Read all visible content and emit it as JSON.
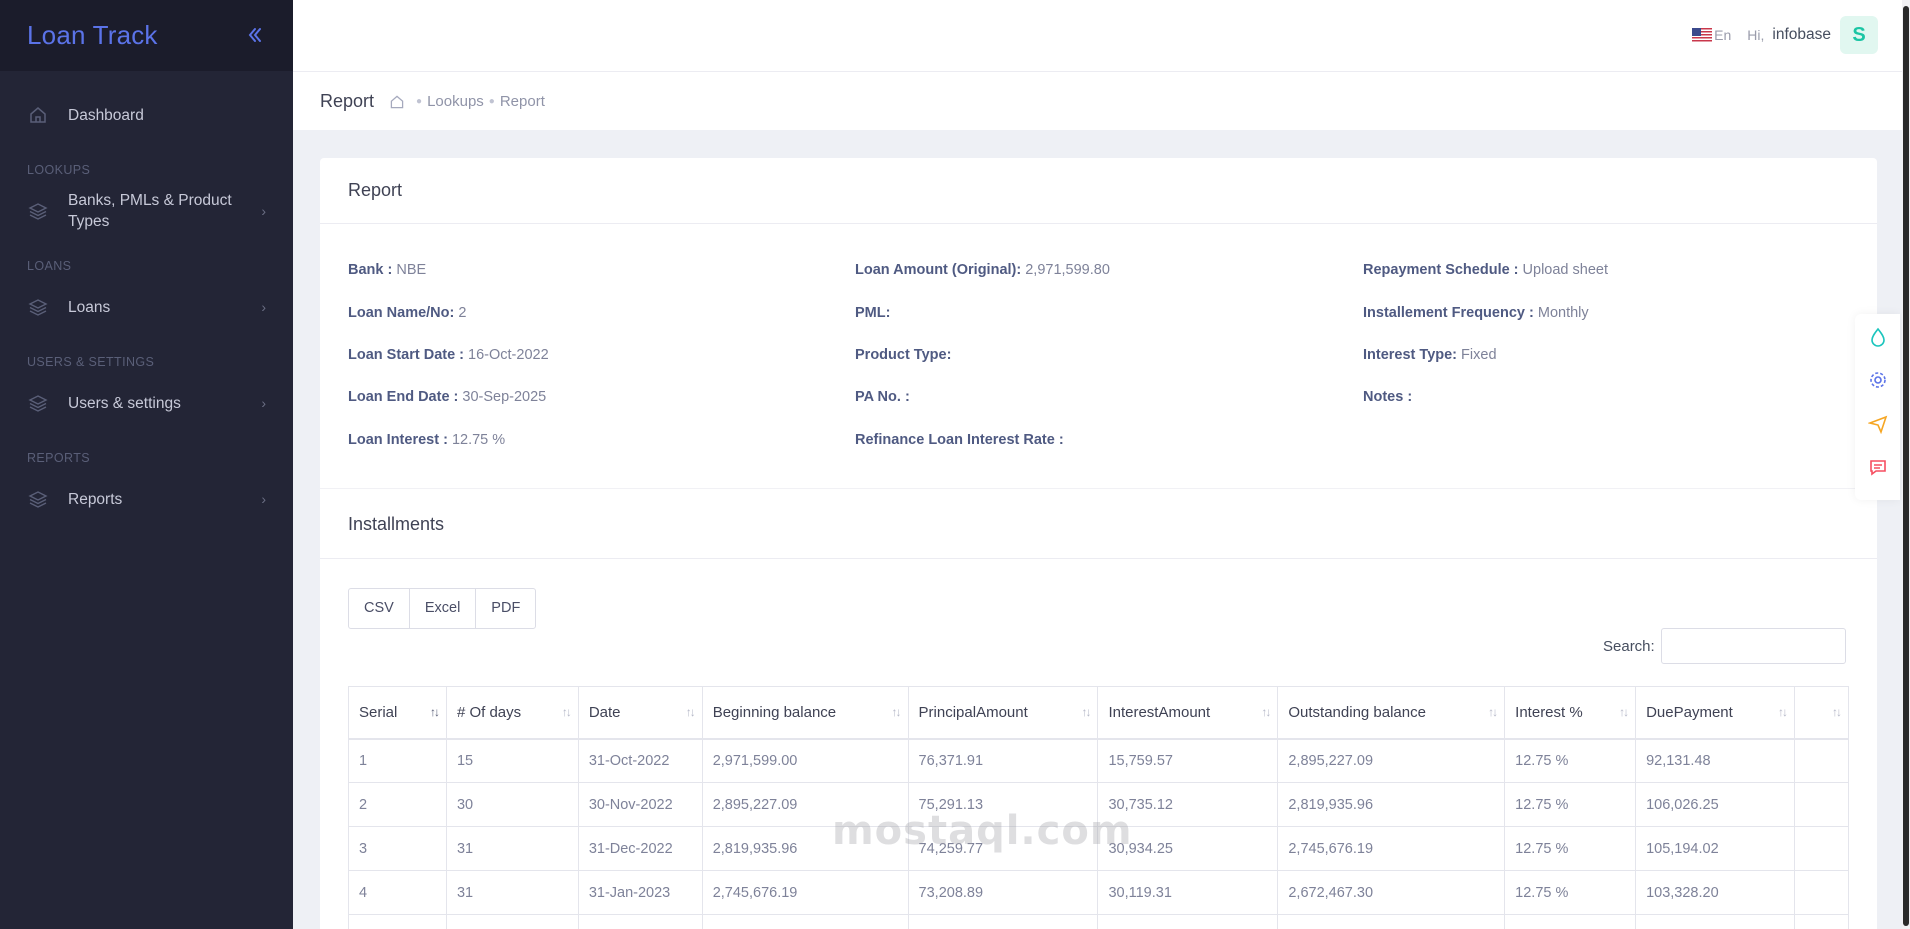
{
  "app": {
    "title": "Loan Track"
  },
  "sidebar": {
    "dashboard": "Dashboard",
    "sections": [
      "LOOKUPS",
      "LOANS",
      "USERS & SETTINGS",
      "REPORTS"
    ],
    "items": [
      {
        "label": "Banks, PMLs & Product Types",
        "icon": "layers-icon"
      },
      {
        "label": "Loans",
        "icon": "layers-icon"
      },
      {
        "label": "Users & settings",
        "icon": "layers-icon"
      },
      {
        "label": "Reports",
        "icon": "layers-icon"
      }
    ]
  },
  "header": {
    "lang": "En",
    "greeting": "Hi,",
    "username": "infobase",
    "avatar": "S"
  },
  "subheader": {
    "title": "Report",
    "crumbs": [
      "Lookups",
      "Report"
    ]
  },
  "report": {
    "title": "Report",
    "fields": {
      "bank": {
        "label": "Bank :",
        "value": "NBE"
      },
      "loan_name": {
        "label": "Loan Name/No:",
        "value": "2"
      },
      "loan_start": {
        "label": "Loan Start Date :",
        "value": "16-Oct-2022"
      },
      "loan_end": {
        "label": "Loan End Date :",
        "value": "30-Sep-2025"
      },
      "loan_interest": {
        "label": "Loan Interest :",
        "value": "12.75 %"
      },
      "loan_amount": {
        "label": "Loan Amount (Original):",
        "value": "2,971,599.80"
      },
      "pml": {
        "label": "PML:",
        "value": ""
      },
      "product_type": {
        "label": "Product Type:",
        "value": ""
      },
      "pa_no": {
        "label": "PA No. :",
        "value": ""
      },
      "refinance": {
        "label": "Refinance Loan Interest Rate :",
        "value": ""
      },
      "repayment": {
        "label": "Repayment Schedule :",
        "value": "Upload sheet"
      },
      "frequency": {
        "label": "Installement Frequency :",
        "value": "Monthly"
      },
      "interest_type": {
        "label": "Interest Type:",
        "value": "Fixed"
      },
      "notes": {
        "label": "Notes :",
        "value": ""
      }
    }
  },
  "installments": {
    "title": "Installments",
    "export": [
      "CSV",
      "Excel",
      "PDF"
    ],
    "search_label": "Search:",
    "columns": [
      "Serial",
      "# Of days",
      "Date",
      "Beginning balance",
      "PrincipalAmount",
      "InterestAmount",
      "Outstanding balance",
      "Interest %",
      "DuePayment",
      ""
    ],
    "rows": [
      [
        "1",
        "15",
        "31-Oct-2022",
        "2,971,599.00",
        "76,371.91",
        "15,759.57",
        "2,895,227.09",
        "12.75 %",
        "92,131.48",
        ""
      ],
      [
        "2",
        "30",
        "30-Nov-2022",
        "2,895,227.09",
        "75,291.13",
        "30,735.12",
        "2,819,935.96",
        "12.75 %",
        "106,026.25",
        ""
      ],
      [
        "3",
        "31",
        "31-Dec-2022",
        "2,819,935.96",
        "74,259.77",
        "30,934.25",
        "2,745,676.19",
        "12.75 %",
        "105,194.02",
        ""
      ],
      [
        "4",
        "31",
        "31-Jan-2023",
        "2,745,676.19",
        "73,208.89",
        "30,119.31",
        "2,672,467.30",
        "12.75 %",
        "103,328.20",
        ""
      ],
      [
        "",
        "",
        "",
        "",
        "",
        "",
        "",
        "",
        "",
        ""
      ]
    ]
  },
  "watermark": "mostaql.com",
  "colors": {
    "accent": "#5b73e8",
    "sidebar": "#232536",
    "avatar_bg": "#e1f7f0",
    "avatar_fg": "#1bc5a4"
  }
}
